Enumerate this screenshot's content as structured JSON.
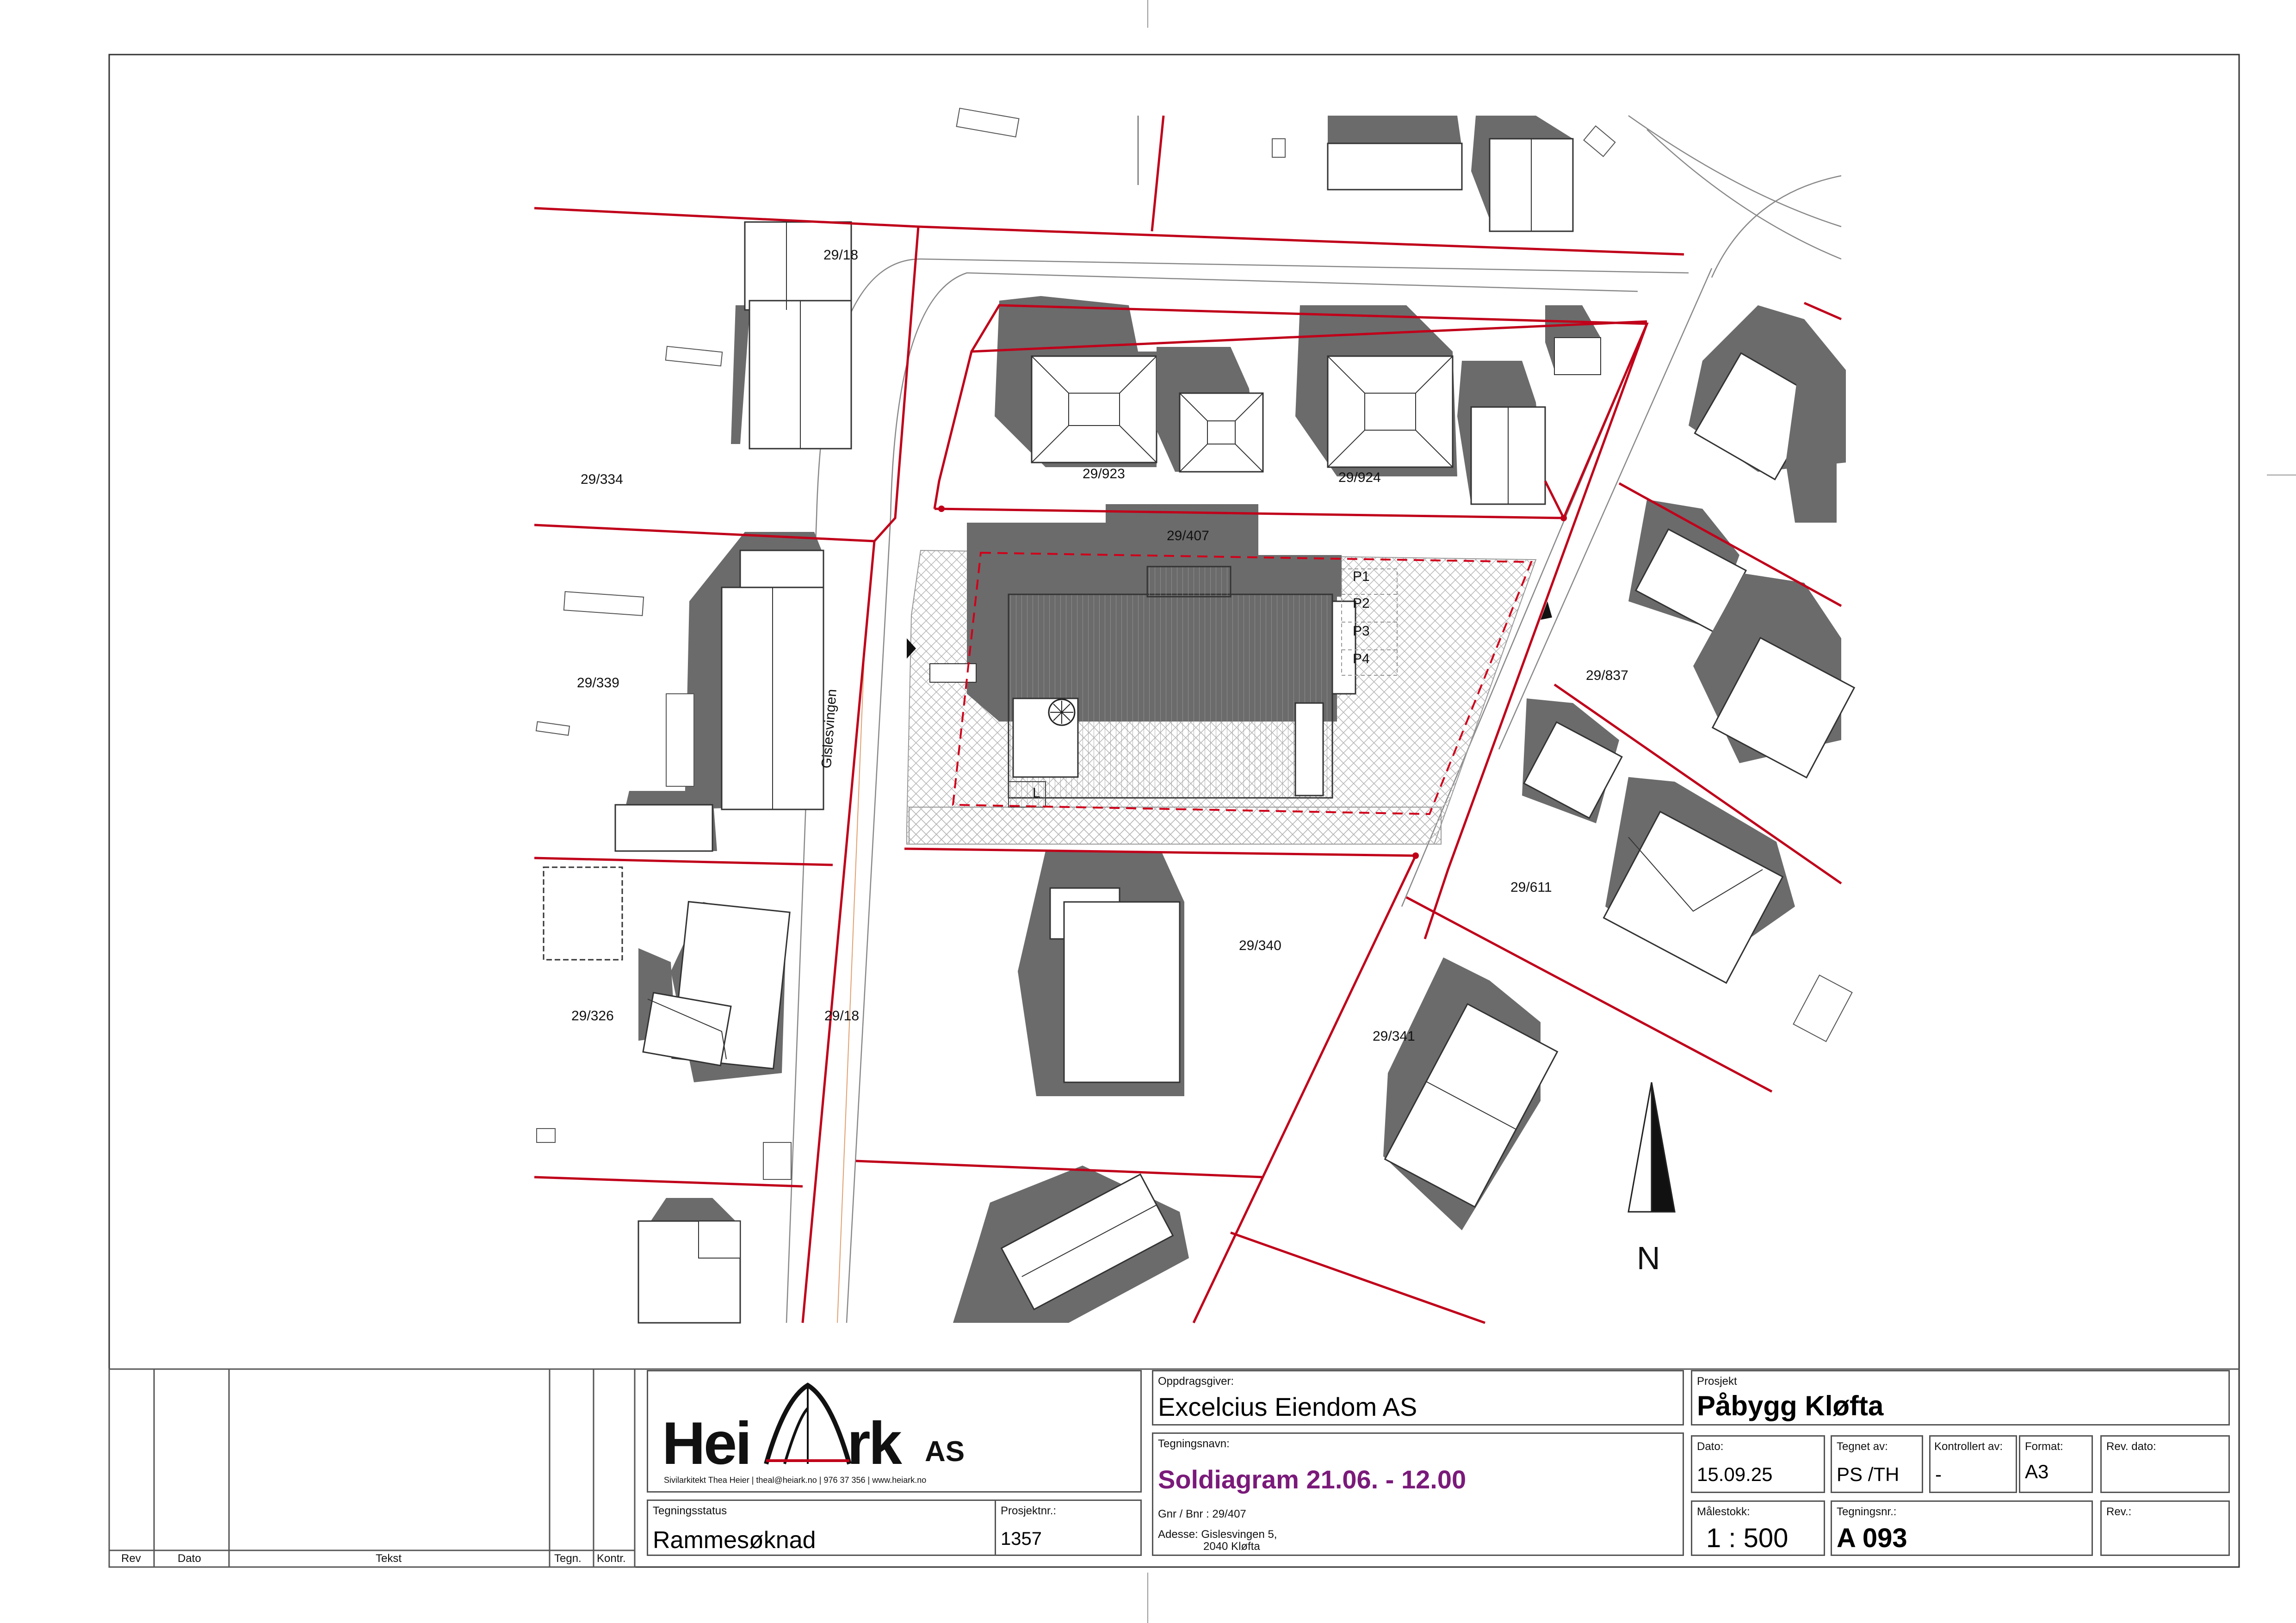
{
  "site_plan": {
    "parcel_labels": {
      "p_29_18_top": "29/18",
      "p_29_334": "29/334",
      "p_29_923": "29/923",
      "p_29_924": "29/924",
      "p_29_407": "29/407",
      "p_29_339": "29/339",
      "p_29_837": "29/837",
      "p_29_611": "29/611",
      "p_29_340": "29/340",
      "p_29_326": "29/326",
      "p_29_18_bottom": "29/18",
      "p_29_341": "29/341"
    },
    "road_name": "Gislesvingen",
    "parking_spots": [
      "P1",
      "P2",
      "P3",
      "P4"
    ],
    "play_area_label": "L",
    "north_label": "N",
    "colors": {
      "property_line": "#c0001a",
      "building_shadow": "#6b6b6b",
      "building_outline": "#333333",
      "site_boundary": "#d0001a",
      "title_highlight": "#7a1a7a"
    }
  },
  "title_block": {
    "revision_table": {
      "headers": [
        "Rev",
        "Dato",
        "Tekst",
        "Tegn.",
        "Kontr."
      ]
    },
    "logo": {
      "name_left": "Hei",
      "name_right": "rk",
      "suffix": "AS",
      "subline": "Sivilarkitekt Thea Heier  |  theal@heiark.no  |  976 37 356  |  www.heiark.no"
    },
    "oppdragsgiver_label": "Oppdragsgiver:",
    "oppdragsgiver": "Excelcius Eiendom AS",
    "prosjekt_label": "Prosjekt",
    "prosjekt": "Påbygg Kløfta",
    "tegningsnavn_label": "Tegningsnavn:",
    "tegningsnavn": "Soldiagram 21.06. - 12.00",
    "gnr_line": "Gnr / Bnr :  29/407",
    "adresse_line1": "Adesse: Gislesvingen 5,",
    "adresse_line2": "2040 Kløfta",
    "tegningsstatus_label": "Tegningsstatus",
    "tegningsstatus": "Rammesøknad",
    "prosjektnr_label": "Prosjektnr.:",
    "prosjektnr": "1357",
    "dato_label": "Dato:",
    "dato": "15.09.25",
    "tegnet_av_label": "Tegnet av:",
    "tegnet_av": "PS /TH",
    "kontrollert_av_label": "Kontrollert av:",
    "kontrollert_av": "-",
    "format_label": "Format:",
    "format": "A3",
    "rev_dato_label": "Rev. dato:",
    "malestokk_label": "Målestokk:",
    "malestokk": "1 : 500",
    "tegningsnr_label": "Tegningsnr.:",
    "tegningsnr": "A 093",
    "rev_label": "Rev.:"
  }
}
